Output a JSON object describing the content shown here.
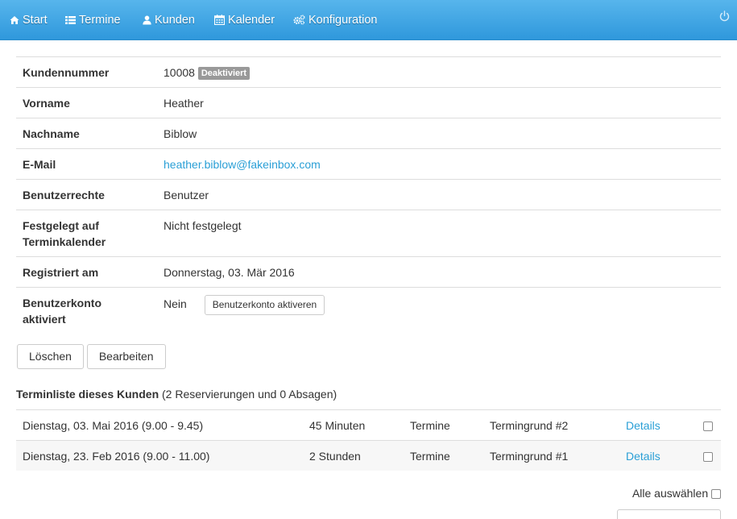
{
  "nav": {
    "items": [
      {
        "label": "Start",
        "icon": "home-icon"
      },
      {
        "label": "Termine",
        "icon": "list-icon"
      },
      {
        "label": "Kunden",
        "icon": "user-icon"
      },
      {
        "label": "Kalender",
        "icon": "calendar-icon"
      },
      {
        "label": "Konfiguration",
        "icon": "gears-icon"
      }
    ],
    "power_icon": "power-icon"
  },
  "customer": {
    "rows": [
      {
        "label": "Kundennummer",
        "value": "10008",
        "badge": "Deaktiviert"
      },
      {
        "label": "Vorname",
        "value": "Heather"
      },
      {
        "label": "Nachname",
        "value": "Biblow"
      },
      {
        "label": "E-Mail",
        "value": "heather.biblow@fakeinbox.com"
      },
      {
        "label": "Benutzerrechte",
        "value": "Benutzer"
      },
      {
        "label": "Festgelegt auf Terminkalender",
        "value": "Nicht festgelegt"
      },
      {
        "label": "Registriert am",
        "value": "Donnerstag, 03. Mär 2016"
      },
      {
        "label": "Benutzerkonto aktiviert",
        "value": "Nein",
        "button": "Benutzerkonto aktiveren"
      }
    ]
  },
  "actions": {
    "delete_label": "Löschen",
    "edit_label": "Bearbeiten"
  },
  "appointments": {
    "title": "Terminliste dieses Kunden",
    "summary": "(2 Reservierungen und 0 Absagen)",
    "rows": [
      {
        "date": "Dienstag, 03. Mai 2016 (9.00 - 9.45)",
        "duration": "45 Minuten",
        "type": "Termine",
        "reason": "Termingrund #2",
        "details": "Details"
      },
      {
        "date": "Dienstag, 23. Feb 2016 (9.00 - 11.00)",
        "duration": "2 Stunden",
        "type": "Termine",
        "reason": "Termingrund #1",
        "details": "Details"
      }
    ],
    "select_all_label": "Alle auswählen"
  },
  "colors": {
    "navbar": "#3aa3e3",
    "link": "#2a9fd6",
    "badge": "#999999"
  }
}
